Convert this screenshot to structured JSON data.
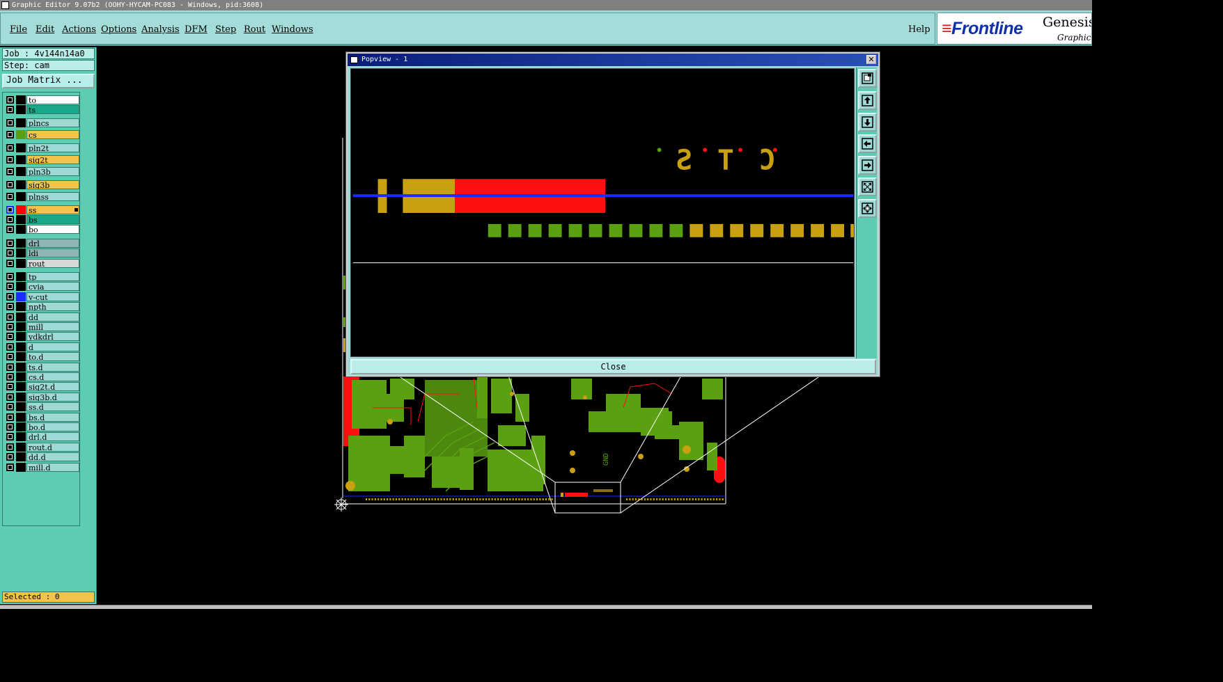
{
  "window": {
    "title": "Graphic Editor 9.07b2 (OOHY-HYCAM-PC083 - Windows, pid:3608)"
  },
  "menu": {
    "items": [
      {
        "label": "File"
      },
      {
        "label": "Edit"
      },
      {
        "label": "Actions"
      },
      {
        "label": "Options"
      },
      {
        "label": "Analysis"
      },
      {
        "label": "DFM"
      },
      {
        "label": "Step"
      },
      {
        "label": "Rout"
      },
      {
        "label": "Windows"
      }
    ],
    "help": "Help"
  },
  "brand": {
    "logo": "Frontline",
    "product": "Genesis",
    "subtitle": "Graphic E"
  },
  "left_panel": {
    "job": "Job : 4v144n14a0",
    "step": "Step: cam",
    "job_matrix_button": "Job Matrix ...",
    "selected": "Selected : 0"
  },
  "layers": [
    {
      "name": "to",
      "bg": "#ffffff",
      "swatch": "#000000"
    },
    {
      "name": "ts",
      "bg": "#1aa88a",
      "swatch": "#000000"
    },
    {
      "name": "plncs",
      "bg": "#9ed9d6",
      "swatch": "#000000"
    },
    {
      "name": "cs",
      "bg": "#f5c24a",
      "swatch": "#5aa010"
    },
    {
      "name": "pln2t",
      "bg": "#9ed9d6",
      "swatch": "#000000"
    },
    {
      "name": "sig2t",
      "bg": "#f5c24a",
      "swatch": "#000000"
    },
    {
      "name": "pln3b",
      "bg": "#9ed9d6",
      "swatch": "#000000"
    },
    {
      "name": "sig3b",
      "bg": "#f5c24a",
      "swatch": "#000000"
    },
    {
      "name": "plnss",
      "bg": "#9ed9d6",
      "swatch": "#000000"
    },
    {
      "name": "ss",
      "bg": "#f5c24a",
      "swatch": "#ff0000",
      "active": true
    },
    {
      "name": "bs",
      "bg": "#1aa88a",
      "swatch": "#000000"
    },
    {
      "name": "bo",
      "bg": "#ffffff",
      "swatch": "#000000"
    },
    {
      "name": "drl",
      "bg": "#8fb5b5",
      "swatch": "#000000"
    },
    {
      "name": "ldi",
      "bg": "#8fb5b5",
      "swatch": "#000000"
    },
    {
      "name": "rout",
      "bg": "#d8d8d8",
      "swatch": "#000000"
    },
    {
      "name": "tp",
      "bg": "#9ed9d6",
      "swatch": "#000000"
    },
    {
      "name": "cvia",
      "bg": "#9ed9d6",
      "swatch": "#000000"
    },
    {
      "name": "v-cut",
      "bg": "#9ed9d6",
      "swatch": "#1a2cff"
    },
    {
      "name": "npth",
      "bg": "#9ed9d6",
      "swatch": "#000000"
    },
    {
      "name": "dd",
      "bg": "#9ed9d6",
      "swatch": "#000000"
    },
    {
      "name": "mill",
      "bg": "#9ed9d6",
      "swatch": "#000000"
    },
    {
      "name": "ydkdrl",
      "bg": "#9ed9d6",
      "swatch": "#000000"
    },
    {
      "name": "d",
      "bg": "#9ed9d6",
      "swatch": "#000000"
    },
    {
      "name": "to.d",
      "bg": "#9ed9d6",
      "swatch": "#000000"
    },
    {
      "name": "ts.d",
      "bg": "#9ed9d6",
      "swatch": "#000000"
    },
    {
      "name": "cs.d",
      "bg": "#9ed9d6",
      "swatch": "#000000"
    },
    {
      "name": "sig2t.d",
      "bg": "#9ed9d6",
      "swatch": "#000000"
    },
    {
      "name": "sig3b.d",
      "bg": "#9ed9d6",
      "swatch": "#000000"
    },
    {
      "name": "ss.d",
      "bg": "#9ed9d6",
      "swatch": "#000000"
    },
    {
      "name": "bs.d",
      "bg": "#9ed9d6",
      "swatch": "#000000"
    },
    {
      "name": "bo.d",
      "bg": "#9ed9d6",
      "swatch": "#000000"
    },
    {
      "name": "drl.d",
      "bg": "#9ed9d6",
      "swatch": "#000000"
    },
    {
      "name": "rout.d",
      "bg": "#9ed9d6",
      "swatch": "#000000"
    },
    {
      "name": "dd.d",
      "bg": "#9ed9d6",
      "swatch": "#000000"
    },
    {
      "name": "mill.d",
      "bg": "#9ed9d6",
      "swatch": "#000000"
    }
  ],
  "board": {
    "text_gnd": "GND"
  },
  "popview": {
    "title": "Popview - 1",
    "close_label": "Close",
    "close_x": "✕",
    "silk_text": "C T S",
    "tools": [
      {
        "icon": "zoom-window-icon"
      },
      {
        "icon": "pan-up-icon"
      },
      {
        "icon": "pan-down-icon"
      },
      {
        "icon": "pan-left-icon"
      },
      {
        "icon": "pan-right-icon"
      },
      {
        "icon": "zoom-extents-icon"
      },
      {
        "icon": "zoom-home-icon"
      }
    ]
  },
  "colors": {
    "panel_bg": "#5ccdb3",
    "menu_bg": "#9ed9d6",
    "copper_green": "#5aa010",
    "copper_gold": "#c8a010",
    "pad_red": "#ff1010",
    "vcut_blue": "#1a2cff"
  }
}
